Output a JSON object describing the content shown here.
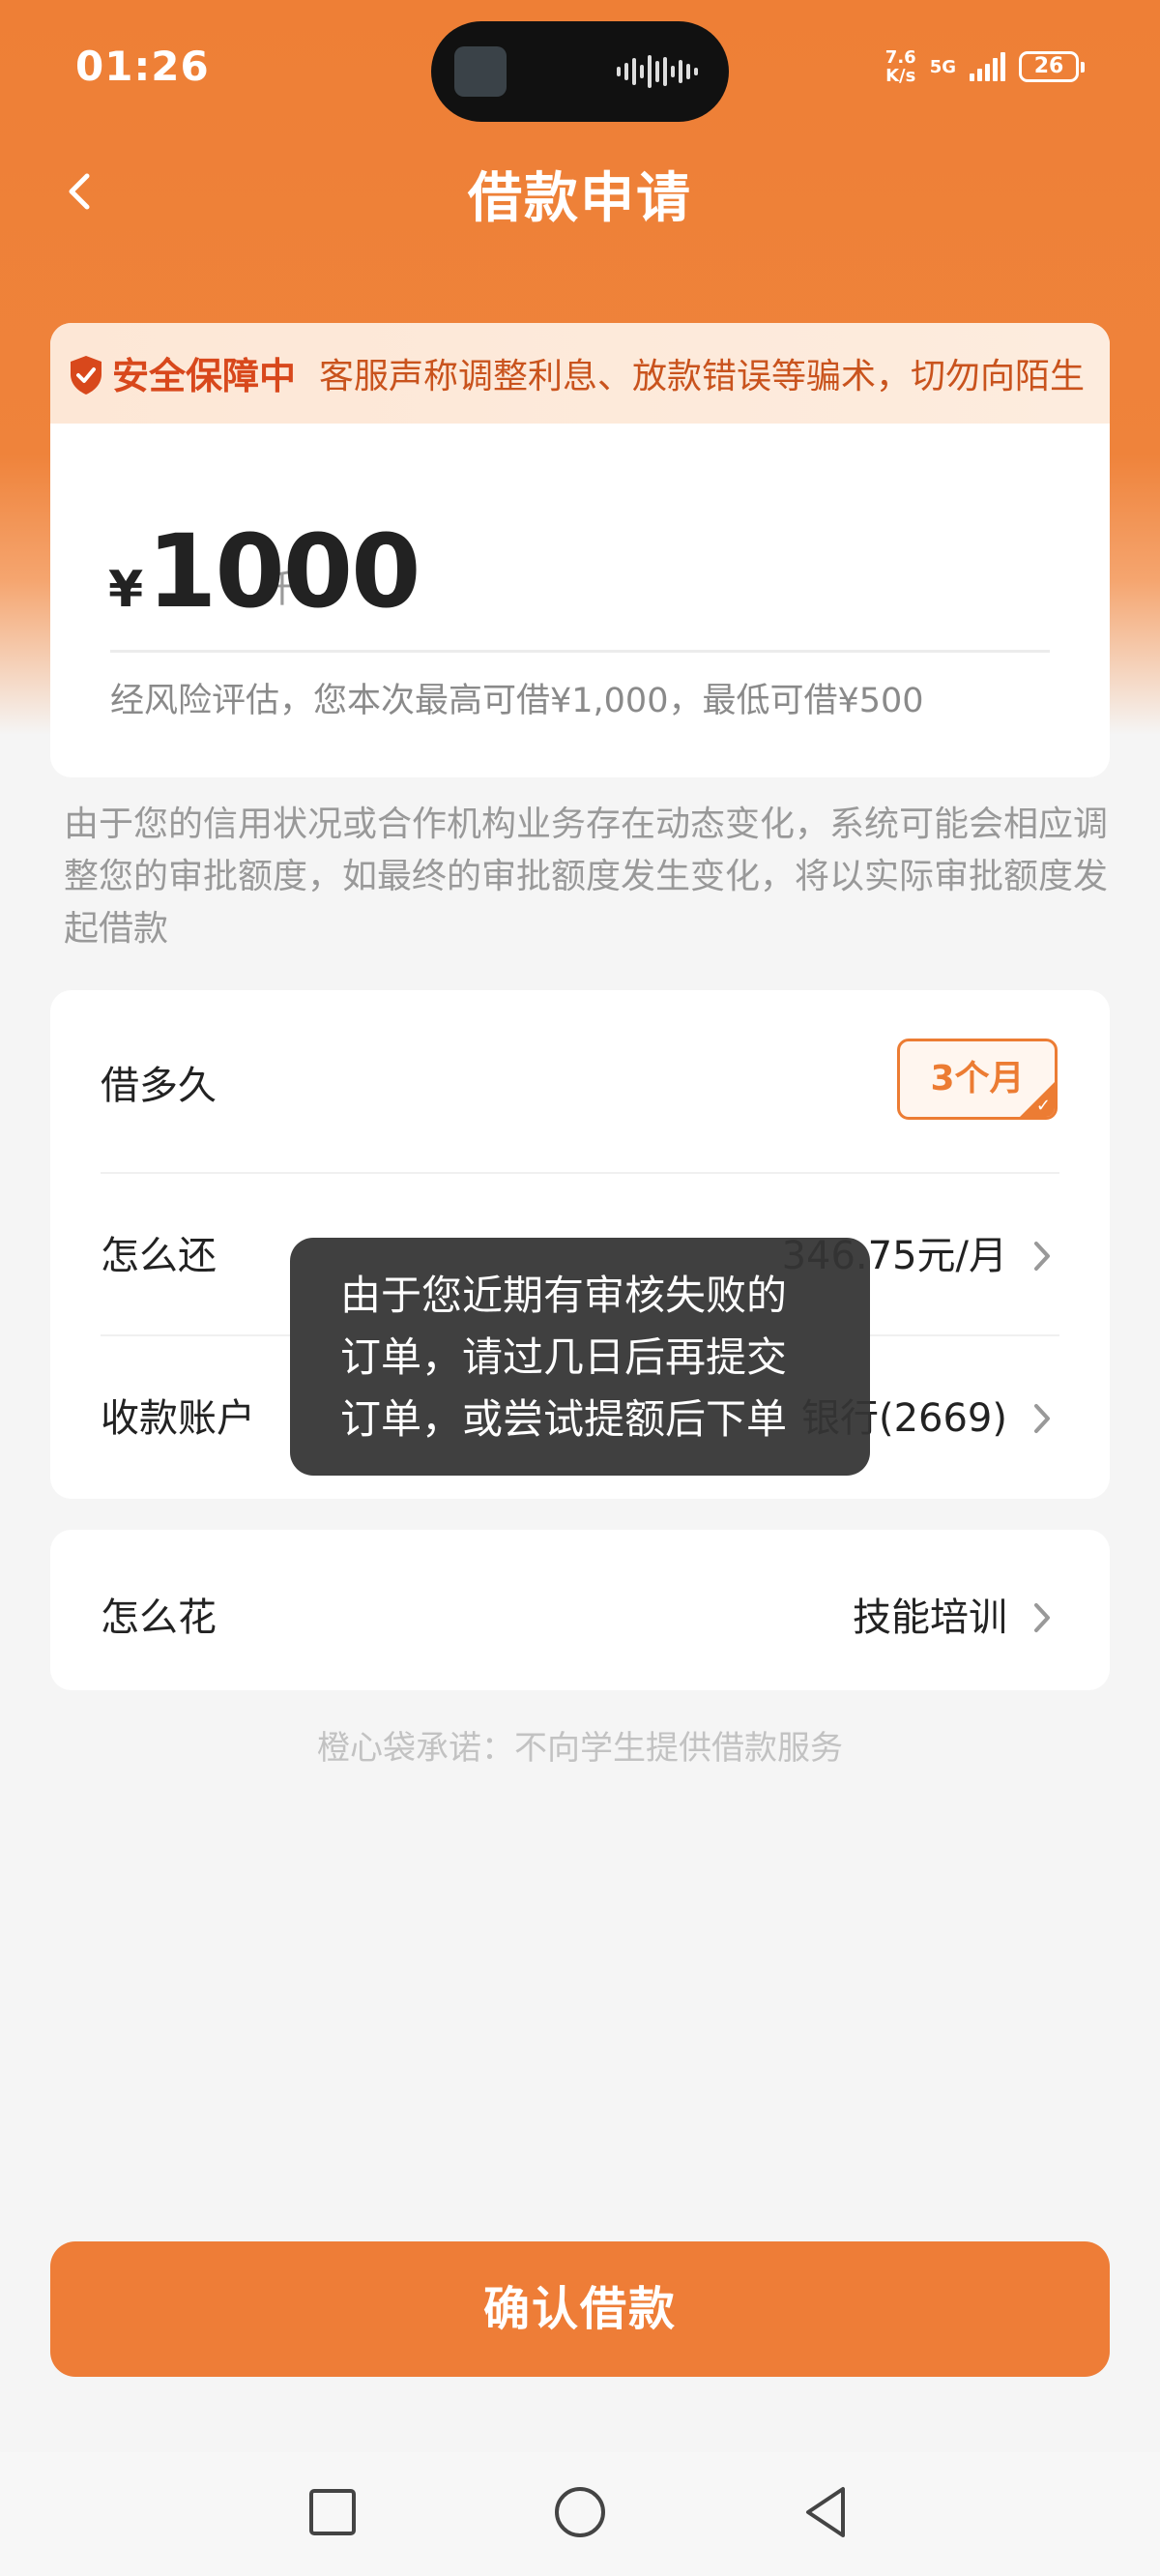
{
  "status_bar": {
    "time": "01:26",
    "net_speed_value": "7.6",
    "net_speed_unit": "K/s",
    "network": "5G",
    "battery": "26"
  },
  "header": {
    "title": "借款申请",
    "back_icon": "chevron-left-icon"
  },
  "security_banner": {
    "badge": "安全保障中",
    "ticker": "客服声称调整利息、放款错误等骗术，切勿向陌生"
  },
  "loan_amount": {
    "unit_hint": "千",
    "currency": "¥",
    "value": "1000",
    "risk_note": "经风险评估，您本次最高可借¥1,000，最低可借¥500"
  },
  "notice": "由于您的信用状况或合作机构业务存在动态变化，系统可能会相应调整您的审批额度，如最终的审批额度发生变化，将以实际审批额度发起借款",
  "options": {
    "term": {
      "label": "借多久",
      "value": "3个月"
    },
    "repay": {
      "label": "怎么还",
      "value": "346.75元/月"
    },
    "account": {
      "label": "收款账户",
      "value": "银行(2669)"
    },
    "usage": {
      "label": "怎么花",
      "value": "技能培训"
    }
  },
  "promise": "橙心袋承诺：不向学生提供借款服务",
  "toast": "由于您近期有审核失败的订单，请过几日后再提交订单，或尝试提额后下单",
  "confirm_button": "确认借款",
  "colors": {
    "brand": "#ee7d37",
    "warning_text": "#d8481c"
  }
}
